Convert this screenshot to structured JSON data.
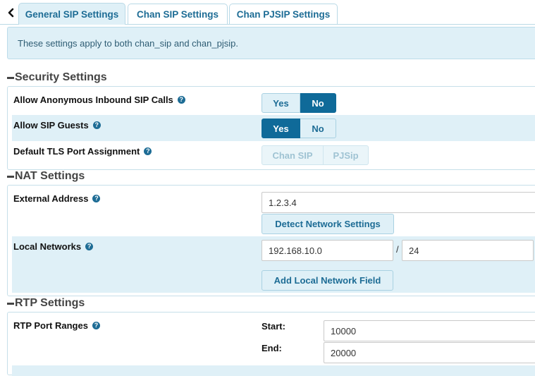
{
  "tabs": [
    {
      "label": "General SIP Settings"
    },
    {
      "label": "Chan SIP Settings"
    },
    {
      "label": "Chan PJSIP Settings"
    }
  ],
  "info": "These settings apply to both chan_sip and chan_pjsip.",
  "security": {
    "title": "Security Settings",
    "anonymous": {
      "label": "Allow Anonymous Inbound SIP Calls",
      "yes": "Yes",
      "no": "No",
      "selected": "No"
    },
    "guests": {
      "label": "Allow SIP Guests",
      "yes": "Yes",
      "no": "No",
      "selected": "Yes"
    },
    "tls": {
      "label": "Default TLS Port Assignment",
      "opt1": "Chan SIP",
      "opt2": "PJSip"
    }
  },
  "nat": {
    "title": "NAT Settings",
    "external": {
      "label": "External Address",
      "value": "1.2.3.4",
      "detect_button": "Detect Network Settings"
    },
    "local": {
      "label": "Local Networks",
      "network": "192.168.10.0",
      "separator": "/",
      "mask": "24",
      "add_button": "Add Local Network Field"
    }
  },
  "rtp": {
    "title": "RTP Settings",
    "ports": {
      "label": "RTP Port Ranges",
      "start_label": "Start:",
      "start_value": "10000",
      "end_label": "End:",
      "end_value": "20000"
    }
  },
  "colors": {
    "accent": "#0f6a99",
    "highlight": "#dff0f7",
    "tab_text": "#1d6c95"
  }
}
